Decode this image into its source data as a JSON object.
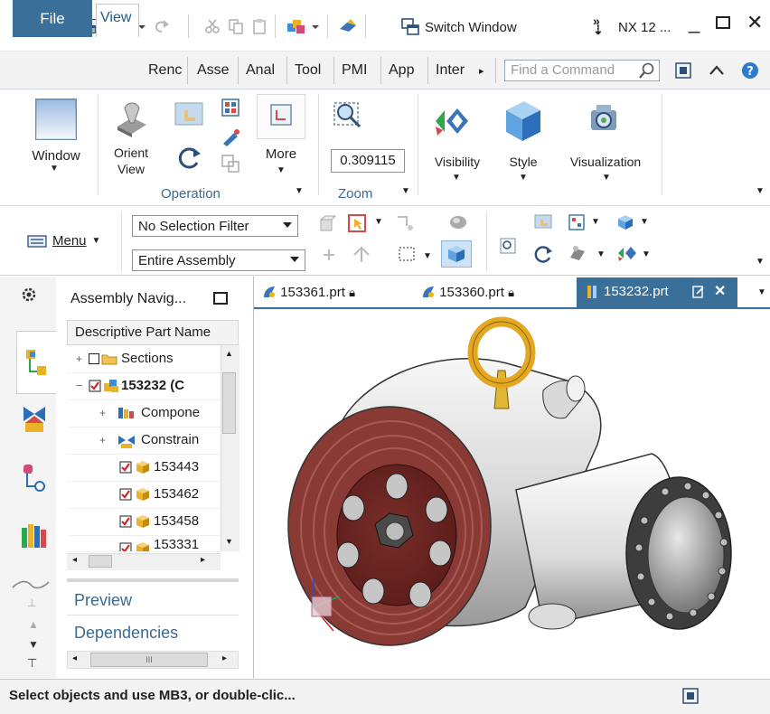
{
  "app": {
    "logo": "NX",
    "window_title": "NX 12 ...",
    "switch_window": "Switch Window"
  },
  "ribbon_tabs": [
    "File",
    "View",
    "Renc",
    "Asse",
    "Anal",
    "Tool",
    "PMI",
    "App",
    "Inter"
  ],
  "find_command_placeholder": "Find a Command",
  "ribbon": {
    "window_label": "Window",
    "orient_view_label": "Orient View",
    "more_label": "More",
    "zoom_value": "0.309115",
    "visibility_label": "Visibility",
    "style_label": "Style",
    "visualization_label": "Visualization",
    "operation_group": "Operation",
    "zoom_group": "Zoom"
  },
  "selection": {
    "menu_label": "Menu",
    "filter_value": "No Selection Filter",
    "scope_value": "Entire Assembly"
  },
  "navigator": {
    "title": "Assembly Navig...",
    "column_header": "Descriptive Part Name",
    "rows": [
      {
        "label": "Sections",
        "bold": false
      },
      {
        "label": "153232 (C",
        "bold": true
      },
      {
        "label": "Compone",
        "bold": false
      },
      {
        "label": "Constrain",
        "bold": false
      },
      {
        "label": "153443",
        "bold": false
      },
      {
        "label": "153462",
        "bold": false
      },
      {
        "label": "153458",
        "bold": false
      },
      {
        "label": "153331",
        "bold": false
      }
    ],
    "preview": "Preview",
    "dependencies": "Dependencies",
    "scroll_label": "III"
  },
  "doc_tabs": [
    "153361.prt",
    "153360.prt",
    "153232.prt"
  ],
  "status": "Select objects and use MB3, or double-clic...",
  "colors": {
    "accent": "#3a6f99",
    "link": "#3b6b92",
    "check_red": "#d7262b",
    "part_yellow": "#e4a722"
  }
}
